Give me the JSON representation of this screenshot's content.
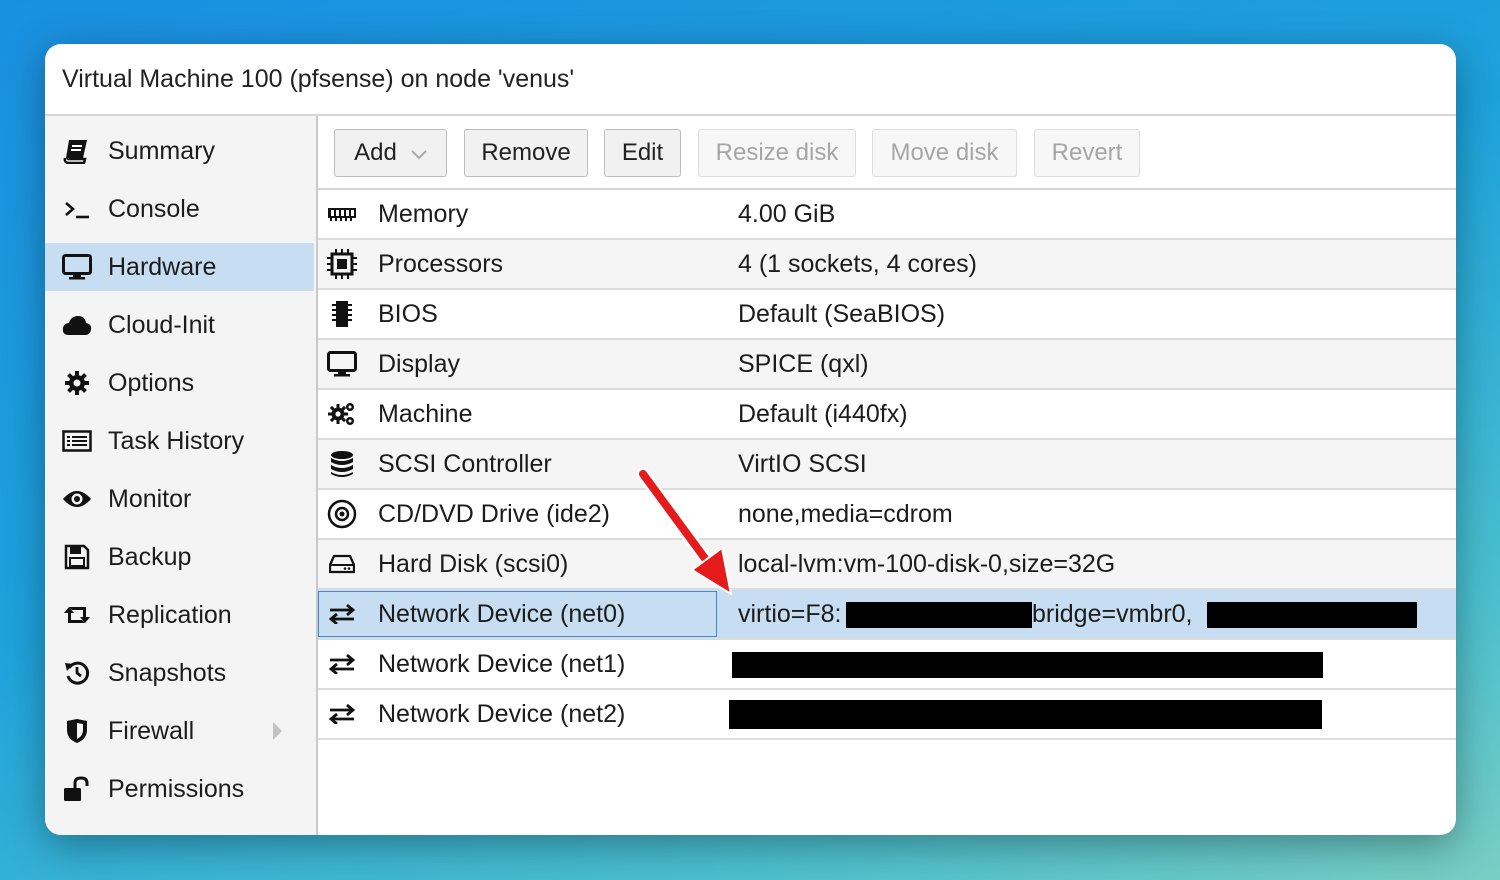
{
  "window": {
    "title": "Virtual Machine 100 (pfsense) on node 'venus'"
  },
  "sidebar": {
    "items": [
      {
        "label": "Summary",
        "icon": "book-icon"
      },
      {
        "label": "Console",
        "icon": "terminal-icon"
      },
      {
        "label": "Hardware",
        "icon": "desktop-icon",
        "active": true
      },
      {
        "label": "Cloud-Init",
        "icon": "cloud-icon"
      },
      {
        "label": "Options",
        "icon": "gear-icon"
      },
      {
        "label": "Task History",
        "icon": "list-icon"
      },
      {
        "label": "Monitor",
        "icon": "eye-icon"
      },
      {
        "label": "Backup",
        "icon": "floppy-icon"
      },
      {
        "label": "Replication",
        "icon": "retweet-icon"
      },
      {
        "label": "Snapshots",
        "icon": "history-icon"
      },
      {
        "label": "Firewall",
        "icon": "shield-icon",
        "has_submenu": true
      },
      {
        "label": "Permissions",
        "icon": "unlock-icon"
      }
    ]
  },
  "toolbar": {
    "add_label": "Add",
    "remove_label": "Remove",
    "edit_label": "Edit",
    "resize_disk_label": "Resize disk",
    "move_disk_label": "Move disk",
    "revert_label": "Revert"
  },
  "hardware": {
    "rows": [
      {
        "name": "Memory",
        "value": "4.00 GiB",
        "icon": "memory-icon"
      },
      {
        "name": "Processors",
        "value": "4 (1 sockets, 4 cores)",
        "icon": "cpu-icon"
      },
      {
        "name": "BIOS",
        "value": "Default (SeaBIOS)",
        "icon": "chip-icon"
      },
      {
        "name": "Display",
        "value": "SPICE (qxl)",
        "icon": "desktop-icon"
      },
      {
        "name": "Machine",
        "value": "Default (i440fx)",
        "icon": "cogs-icon"
      },
      {
        "name": "SCSI Controller",
        "value": "VirtIO SCSI",
        "icon": "database-icon"
      },
      {
        "name": "CD/DVD Drive (ide2)",
        "value": "none,media=cdrom",
        "icon": "cdrom-icon"
      },
      {
        "name": "Hard Disk (scsi0)",
        "value": "local-lvm:vm-100-disk-0,size=32G",
        "icon": "hdd-icon"
      },
      {
        "name": "Network Device (net0)",
        "value_part1": "virtio=F8:",
        "value_part2": "bridge=vmbr0,",
        "icon": "exchange-icon",
        "selected": true
      },
      {
        "name": "Network Device (net1)",
        "icon": "exchange-icon"
      },
      {
        "name": "Network Device (net2)",
        "icon": "exchange-icon"
      }
    ]
  },
  "colors": {
    "selection": "#c7ddf2",
    "annotation_arrow": "#e51b1b",
    "focus_border": "#3f8ad1"
  }
}
